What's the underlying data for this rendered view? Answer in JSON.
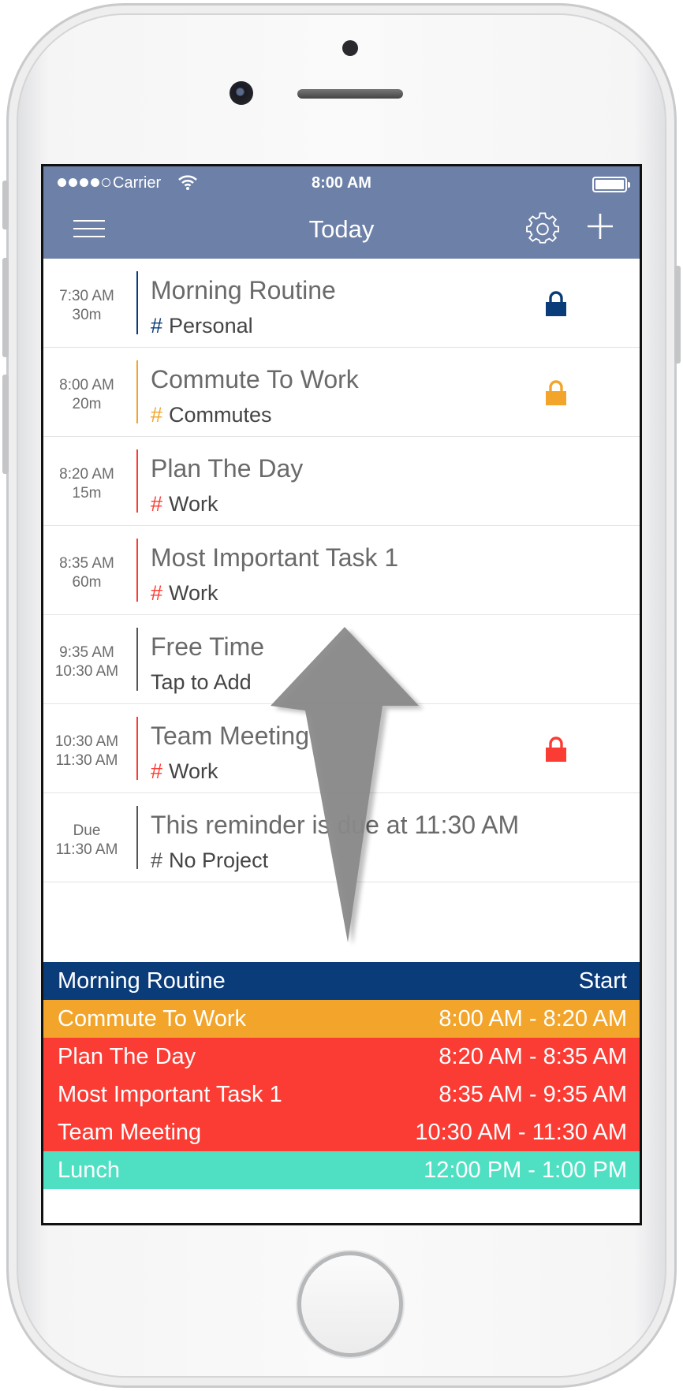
{
  "status_bar": {
    "carrier": "Carrier",
    "time": "8:00 AM"
  },
  "nav": {
    "title": "Today"
  },
  "colors": {
    "header": "#6d80a8",
    "personal": "#0a3c7a",
    "commutes": "#f2a52a",
    "work": "#fb3c34",
    "none": "#555555",
    "lunch": "#4fe0c3"
  },
  "tasks": [
    {
      "time": "7:30 AM",
      "sub": "30m",
      "name": "Morning Routine",
      "hash": "#",
      "project": "Personal",
      "color": "#0a3c7a",
      "lock": true
    },
    {
      "time": "8:00 AM",
      "sub": "20m",
      "name": "Commute To Work",
      "hash": "#",
      "project": "Commutes",
      "color": "#f2a52a",
      "lock": true
    },
    {
      "time": "8:20 AM",
      "sub": "15m",
      "name": "Plan The Day",
      "hash": "#",
      "project": "Work",
      "color": "#fb3c34",
      "lock": false
    },
    {
      "time": "8:35 AM",
      "sub": "60m",
      "name": "Most Important Task 1",
      "hash": "#",
      "project": "Work",
      "color": "#fb3c34",
      "lock": false
    },
    {
      "time": "9:35 AM",
      "sub": "10:30 AM",
      "name": "Free Time",
      "hash": "",
      "project": "Tap to Add",
      "color": "#555555",
      "lock": false
    },
    {
      "time": "10:30 AM",
      "sub": "11:30 AM",
      "name": "Team Meeting",
      "hash": "#",
      "project": "Work",
      "color": "#fb3c34",
      "lock": true
    },
    {
      "time": "Due",
      "sub": "11:30 AM",
      "name": "This reminder is due at 11:30 AM",
      "hash": "#",
      "project": "No Project",
      "color": "#555555",
      "lock": false
    }
  ],
  "timeline": [
    {
      "name": "Morning Routine",
      "range": "Start",
      "color": "#0a3c7a"
    },
    {
      "name": "Commute To Work",
      "range": "8:00 AM - 8:20 AM",
      "color": "#f2a52a"
    },
    {
      "name": "Plan The Day",
      "range": "8:20 AM - 8:35 AM",
      "color": "#fb3c34"
    },
    {
      "name": "Most Important Task 1",
      "range": "8:35 AM - 9:35 AM",
      "color": "#fb3c34"
    },
    {
      "name": "Team Meeting",
      "range": "10:30 AM - 11:30 AM",
      "color": "#fb3c34"
    },
    {
      "name": "Lunch",
      "range": "12:00 PM - 1:00 PM",
      "color": "#4fe0c3"
    }
  ]
}
